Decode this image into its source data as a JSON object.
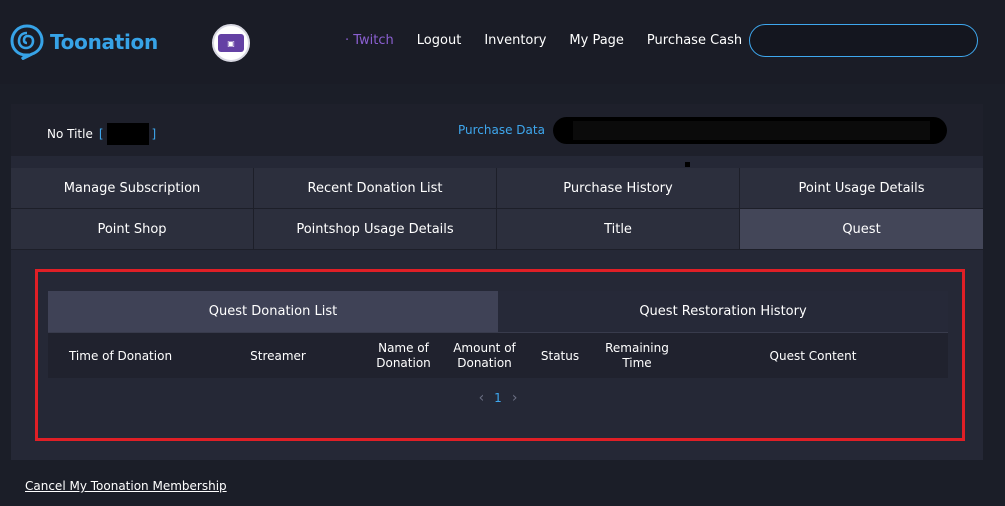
{
  "header": {
    "brand": "Toonation",
    "nav": {
      "twitch": "· Twitch",
      "logout": "Logout",
      "inventory": "Inventory",
      "my_page": "My Page",
      "purchase_cash": "Purchase Cash"
    },
    "search_placeholder": ""
  },
  "title_bar": {
    "no_title": "No Title",
    "bracket_open": "[",
    "bracket_close": "]",
    "purchase_data_label": "Purchase Data"
  },
  "tabs": {
    "row1": [
      "Manage Subscription",
      "Recent Donation List",
      "Purchase History",
      "Point Usage Details"
    ],
    "row2": [
      "Point Shop",
      "Pointshop Usage Details",
      "Title",
      "Quest"
    ],
    "active": "Quest"
  },
  "quest": {
    "subtabs": [
      "Quest Donation List",
      "Quest Restoration History"
    ],
    "active_subtab": "Quest Donation List",
    "columns": [
      "Time of Donation",
      "Streamer",
      "Name of Donation",
      "Amount of Donation",
      "Status",
      "Remaining Time",
      "Quest Content"
    ],
    "pager": {
      "prev": "‹",
      "page": "1",
      "next": "›"
    }
  },
  "footer": {
    "cancel_membership": "Cancel My Toonation Membership"
  },
  "colors": {
    "accent": "#3ea7ee",
    "twitch": "#8a5fd0",
    "highlight_border": "#e01f26"
  }
}
